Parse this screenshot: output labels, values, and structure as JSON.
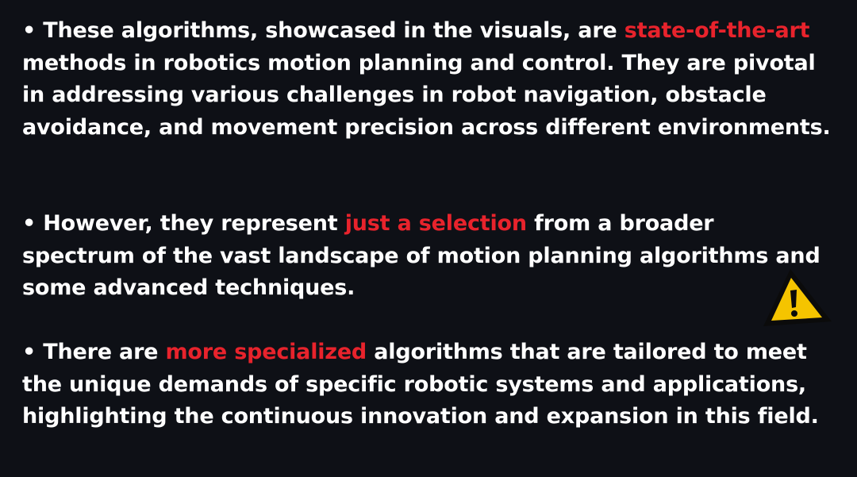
{
  "colors": {
    "background": "#0e1016",
    "text": "#ffffff",
    "highlight": "#e8232c",
    "warning_fill": "#f5c400",
    "warning_outline": "#0b0b0b"
  },
  "bullet_char": "•",
  "bullets": [
    {
      "before": "These algorithms, showcased in the visuals, are ",
      "highlight": "state-of-the-art",
      "after": " methods in robotics motion planning and control. They are pivotal in addressing various challenges in robot navigation, obstacle avoidance, and movement precision across different environments."
    },
    {
      "before": "However, they represent ",
      "highlight": "just a selection",
      "after": " from a broader spectrum of the vast landscape of motion planning algorithms and some advanced techniques."
    },
    {
      "before": "There are ",
      "highlight": "more specialized",
      "after": " algorithms that are tailored to meet the unique demands of specific robotic systems and applications, highlighting the continuous innovation and expansion in this field."
    }
  ],
  "icons": {
    "warning": "warning-triangle-icon"
  }
}
